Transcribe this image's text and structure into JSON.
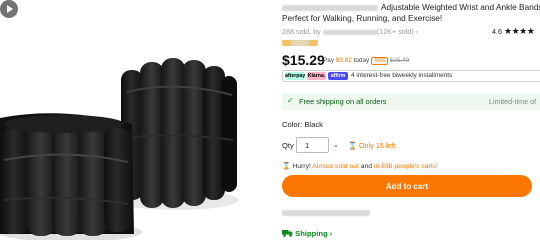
{
  "product": {
    "title_line1": "Adjustable Weighted Wrist and Ankle Bands -",
    "title_line2": "Perfect for Walking, Running, and Exercise!",
    "sold_count": "288 sold, by",
    "store_suffix": "(12K+ sold) ›",
    "rating_value": "4.6",
    "rating_stars": "★★★★",
    "price": "$15.29",
    "pay_prefix": "Pay",
    "pay_amount": "$3.82",
    "pay_today": "today",
    "discount": "-56%",
    "original_price": "$35.49"
  },
  "payment": {
    "afterpay": "afterpay",
    "klarna": "Klarna.",
    "affirm": "affirm",
    "installments": "4 interest-free biweekly installments"
  },
  "shipping_bar": {
    "check_icon": "✓",
    "label": "Free shipping on all orders",
    "limited": "Limited-time of"
  },
  "options": {
    "color_label": "Color: Black",
    "qty_label": "Qty",
    "qty_value": "1",
    "chevron": "⌄",
    "only_left": "⌛ Only 15 left"
  },
  "urgency": {
    "icon": "⌛",
    "prefix": "Hurry!",
    "almost": "Almost sold out",
    "mid": "and",
    "carts": "in 838 people's carts!"
  },
  "actions": {
    "add_to_cart": "Add to cart"
  },
  "footer": {
    "shipping_link": "Shipping ›"
  },
  "colors": {
    "accent": "#fb7701",
    "green": "#0a8a1e",
    "product_black": "#1c1c1c"
  },
  "icons": {
    "play": "play-icon",
    "truck": "truck-icon",
    "check": "check-icon",
    "hourglass": "hourglass-icon",
    "star": "star-icon"
  }
}
